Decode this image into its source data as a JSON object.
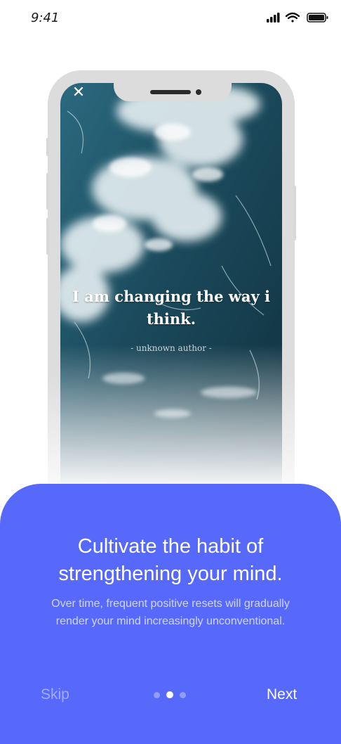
{
  "status_bar": {
    "time": "9:41"
  },
  "preview": {
    "quote": "I am changing the way i think.",
    "author": "- unknown author -"
  },
  "onboarding": {
    "headline": "Cultivate the habit of strengthening your mind.",
    "description": "Over time, frequent positive resets will gradually render your mind increasingly unconventional.",
    "skip_label": "Skip",
    "next_label": "Next",
    "page_count": 3,
    "active_page": 2
  },
  "colors": {
    "accent": "#5669fb",
    "ocean_dark": "#0f2f3c",
    "ocean_mid": "#2b6a80"
  },
  "icons": {
    "close": "close-icon",
    "signal": "signal-icon",
    "wifi": "wifi-icon",
    "battery": "battery-icon"
  }
}
